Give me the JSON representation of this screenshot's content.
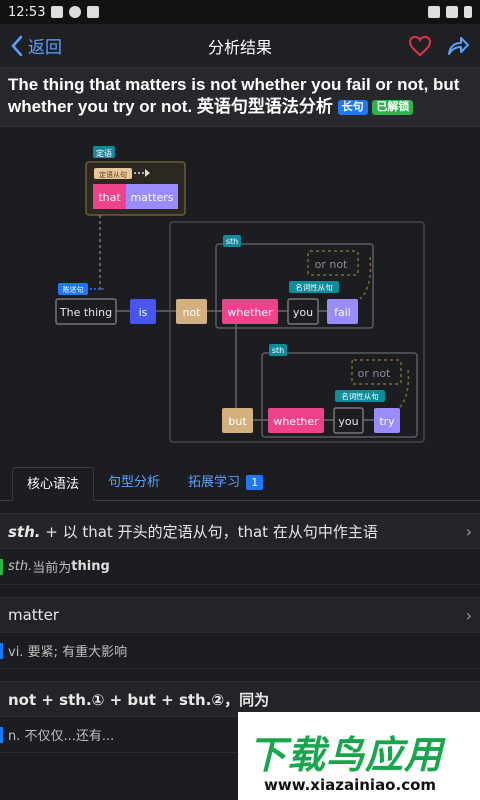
{
  "status": {
    "time": "12:53"
  },
  "nav": {
    "back_label": "返回",
    "title": "分析结果"
  },
  "sentence": {
    "text": "The thing that matters is not whether you fail or not, but whether you try or not. 英语句型语法分析",
    "tag1": "长句",
    "tag2": "已解锁"
  },
  "diagram": {
    "label_attr": "定语",
    "label_attr_clause": "定语从句",
    "label_subj": "陈述句",
    "label_sth1": "sth",
    "label_sth2": "sth",
    "label_noun1": "名词性从句",
    "label_noun2": "名词性从句",
    "w_that": "that",
    "w_matters": "matters",
    "w_thing": "The thing",
    "w_is": "is",
    "w_not": "not",
    "w_whether1": "whether",
    "w_you1": "you",
    "w_fail": "fail",
    "w_ornot1": "or not",
    "w_but": "but",
    "w_whether2": "whether",
    "w_you2": "you",
    "w_try": "try",
    "w_ornot2": "or not",
    "colors": {
      "pink": "#f0428a",
      "purple": "#9a8bff",
      "blue": "#4a54f0",
      "tan": "#d4b07e",
      "teal": "#0f8c9c"
    }
  },
  "tabs": [
    {
      "label": "核心语法"
    },
    {
      "label": "句型分析"
    },
    {
      "label": "拓展学习",
      "badge": "1"
    }
  ],
  "sections": [
    {
      "head_pre": "sth.",
      "head": " + 以 that 开头的定语从句，that 在从句中作主语",
      "body_pre": "sth.",
      "body": "  当前为 ",
      "body_bold": "thing",
      "bar": "#2db34a"
    },
    {
      "head": "matter",
      "body": "vi. 要紧; 有重大影响",
      "bar": "#1e78ff"
    },
    {
      "head": "not + sth.① + but + sth.②，同为",
      "body": "n. 不仅仅...还有...",
      "bar": "#1e78ff"
    }
  ],
  "watermark": {
    "big": "下载鸟应用",
    "small": "www.xiazainiao.com"
  }
}
